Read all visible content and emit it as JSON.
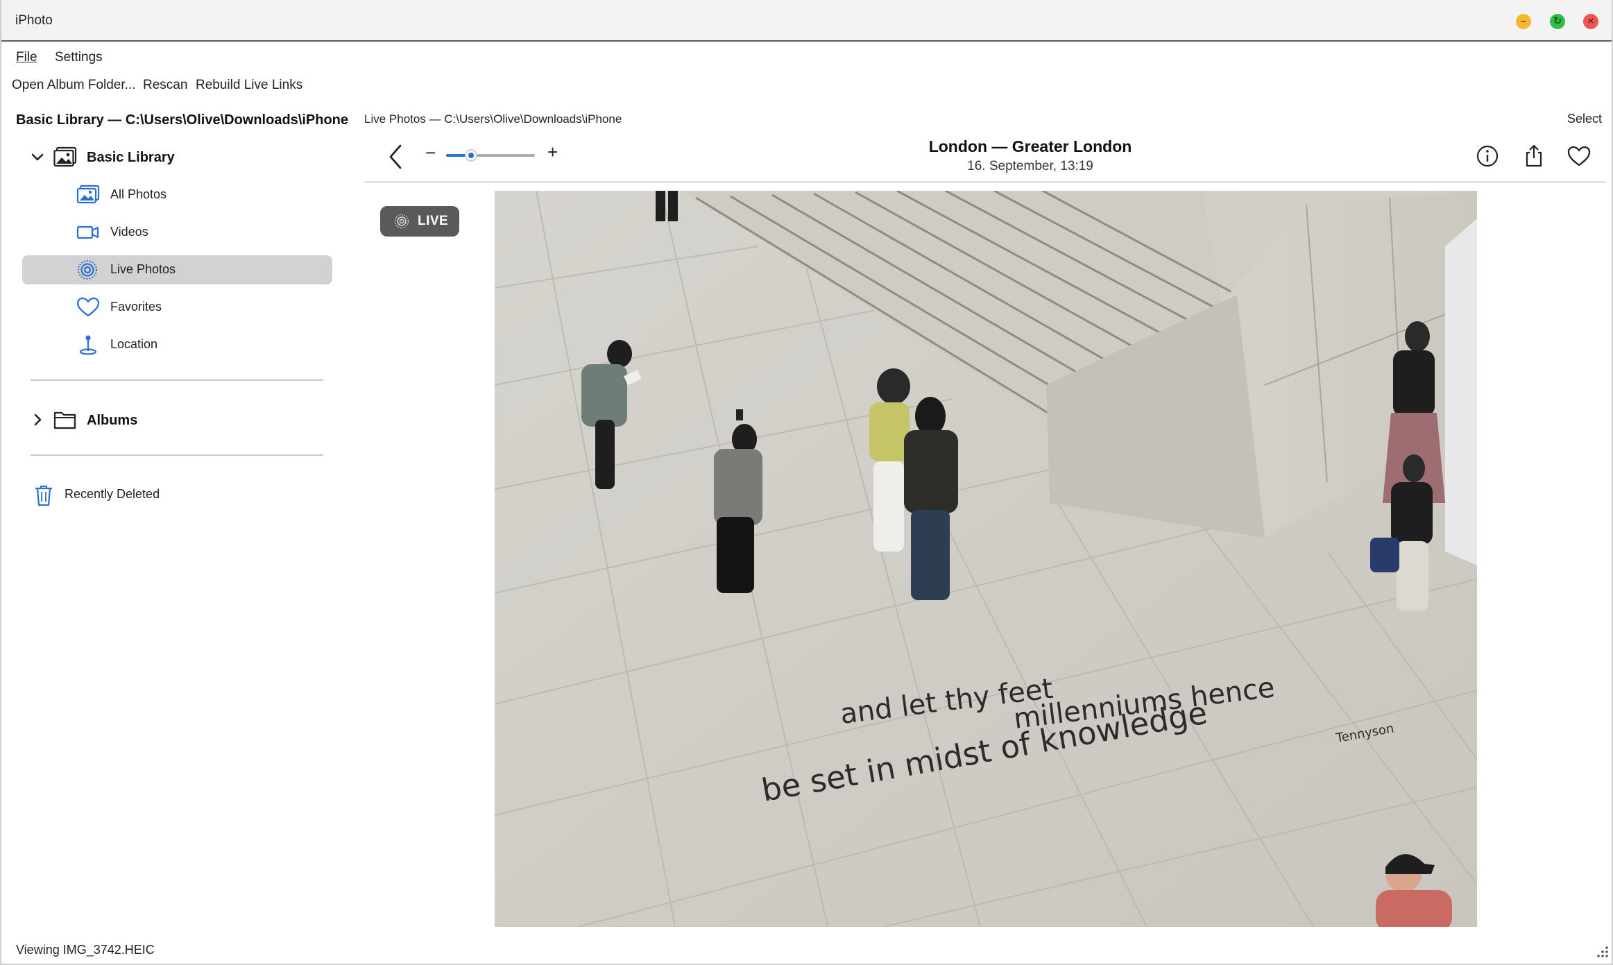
{
  "window": {
    "title": "iPhoto",
    "controls": {
      "minimize": "–",
      "maximize": "↻",
      "close": "×"
    }
  },
  "menu": {
    "file": "File",
    "settings": "Settings"
  },
  "toolbar": {
    "open_album_folder": "Open Album Folder...",
    "rescan": "Rescan",
    "rebuild_live_links": "Rebuild Live Links"
  },
  "sidebar": {
    "library_title": "Basic Library — C:\\Users\\Olive\\Downloads\\iPhone",
    "root": {
      "label": "Basic Library",
      "icon": "photo-library-icon",
      "expanded": true
    },
    "items": [
      {
        "label": "All Photos",
        "icon": "photos-icon",
        "active": false
      },
      {
        "label": "Videos",
        "icon": "video-camera-icon",
        "active": false
      },
      {
        "label": "Live Photos",
        "icon": "live-photo-icon",
        "active": true
      },
      {
        "label": "Favorites",
        "icon": "heart-icon",
        "active": false
      },
      {
        "label": "Location",
        "icon": "location-pin-icon",
        "active": false
      }
    ],
    "albums": {
      "label": "Albums",
      "icon": "folder-icon",
      "expanded": false
    },
    "recently_deleted": {
      "label": "Recently Deleted",
      "icon": "trash-icon"
    }
  },
  "main": {
    "breadcrumb": "Live Photos — C:\\Users\\Olive\\Downloads\\iPhone",
    "select_label": "Select",
    "zoom": {
      "minus": "−",
      "plus": "+",
      "level": 0.28
    },
    "photo_title": "London — Greater London",
    "photo_subtitle": "16. September, 13:19",
    "live_badge": "LIVE",
    "photo": {
      "inscription_line1": "and let thy feet",
      "inscription_line2": "millenniums hence",
      "inscription_line3": "be set in midst of knowledge",
      "inscription_author": "Tennyson"
    }
  },
  "colors": {
    "accent": "#2a6fd6",
    "active_row": "#d2d2d2",
    "badge": "#5a5a5a"
  },
  "status": {
    "text": "Viewing IMG_3742.HEIC"
  }
}
